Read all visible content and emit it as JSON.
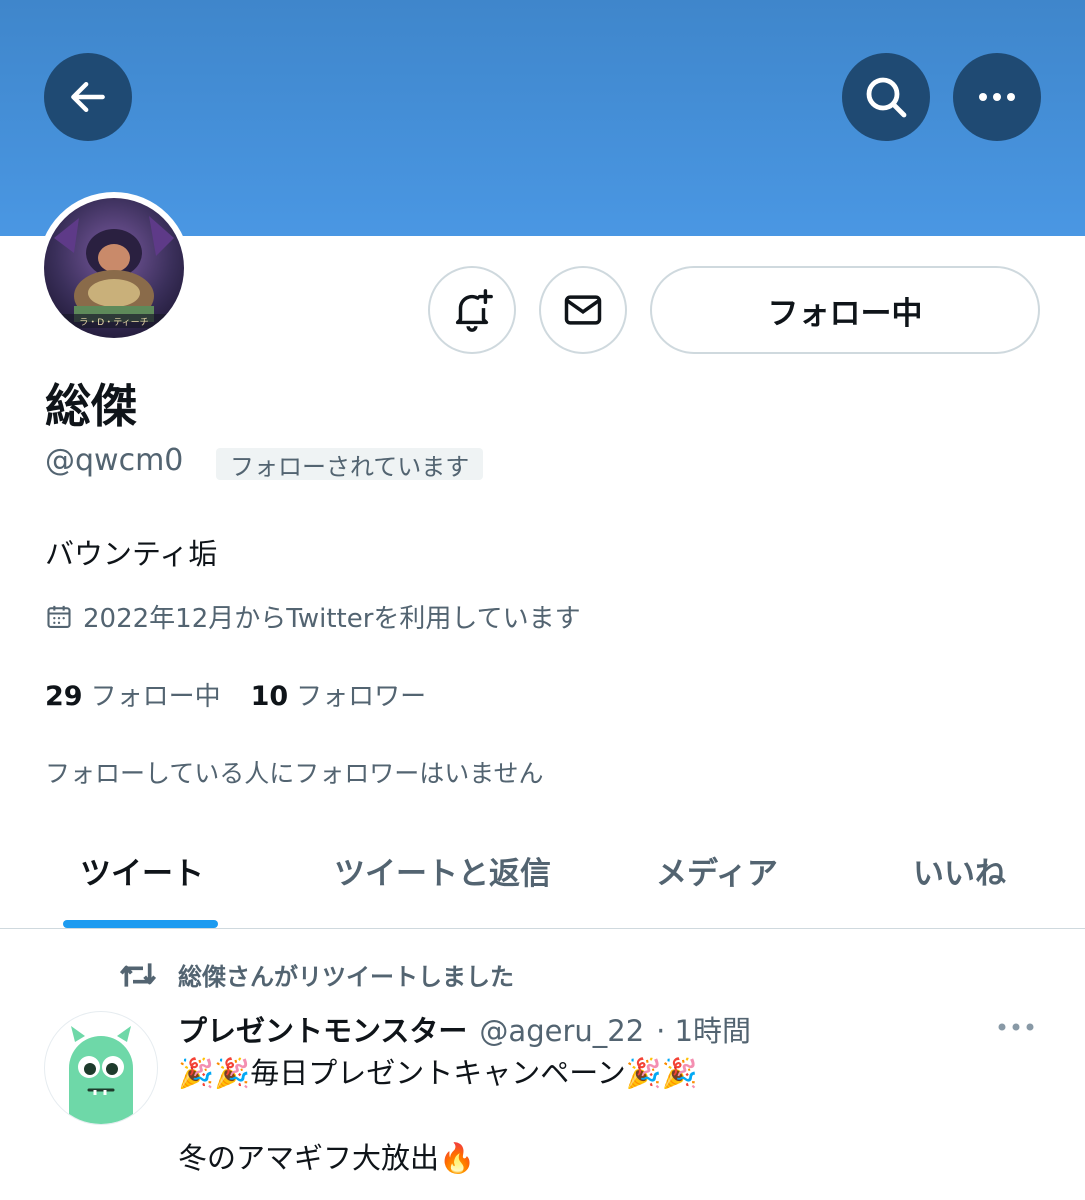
{
  "header": {
    "back_icon": "arrow-left-icon",
    "search_icon": "search-icon",
    "more_icon": "more-horizontal-icon",
    "banner_color": "#4a97e3"
  },
  "profile": {
    "name": "総傑",
    "handle": "@qwcm0",
    "follows_you_badge": "フォローされています",
    "bio": "バウンティ垢",
    "joined": "2022年12月からTwitterを利用しています",
    "following_count": "29",
    "following_label": "フォロー中",
    "followers_count": "10",
    "followers_label": "フォロワー",
    "mutuals_text": "フォローしている人にフォロワーはいません",
    "follow_button_label": "フォロー中",
    "avatar_caption": "ラ・D・ティーチ"
  },
  "tabs": [
    {
      "label": "ツイート",
      "active": true
    },
    {
      "label": "ツイートと返信",
      "active": false
    },
    {
      "label": "メディア",
      "active": false
    },
    {
      "label": "いいね",
      "active": false
    }
  ],
  "tweet": {
    "retweet_text": "総傑さんがリツイートしました",
    "author_name": "プレゼントモンスター",
    "author_handle": "@ageru_22",
    "time": "· 1時間",
    "line1": "🎉🎉毎日プレゼントキャンペーン🎉🎉",
    "line2": "冬のアマギフ大放出🔥"
  },
  "colors": {
    "accent": "#1d9bf0",
    "banner_button": "#1f4a73",
    "secondary_text": "#536471",
    "monster_green": "#6ed8a8"
  }
}
